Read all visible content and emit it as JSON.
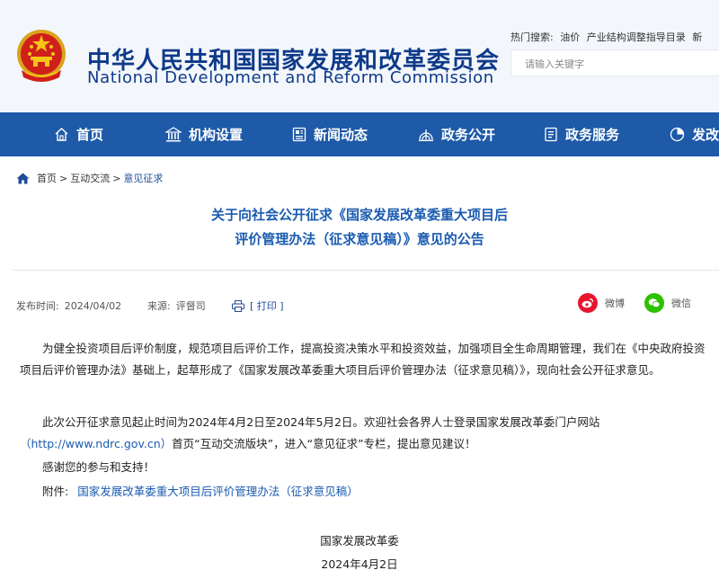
{
  "header": {
    "title_cn": "中华人民共和国国家发展和改革委员会",
    "title_en": "National Development and Reform Commission",
    "hot_search_label": "热门搜索:",
    "hot_search_items": [
      "油价",
      "产业结构调整指导目录",
      "新"
    ],
    "search_placeholder": "请输入关键字"
  },
  "nav": {
    "items": [
      {
        "label": "首页",
        "icon": "home-icon"
      },
      {
        "label": "机构设置",
        "icon": "building-icon"
      },
      {
        "label": "新闻动态",
        "icon": "news-icon"
      },
      {
        "label": "政务公开",
        "icon": "radar-icon"
      },
      {
        "label": "政务服务",
        "icon": "document-icon"
      },
      {
        "label": "发改",
        "icon": "chart-icon"
      }
    ],
    "background": "#1e5aa8"
  },
  "breadcrumb": {
    "items": [
      "首页",
      "互动交流",
      "意见征求"
    ],
    "separator": ">"
  },
  "article": {
    "title_line1": "关于向社会公开征求《国家发展改革委重大项目后",
    "title_line2": "评价管理办法（征求意见稿）》意见的公告",
    "publish_label": "发布时间:",
    "publish_date": "2024/04/02",
    "source_label": "来源:",
    "source_value": "评督司",
    "print_label": "[ 打印 ]",
    "share_weibo": "微博",
    "share_wechat": "微信",
    "para1": "为健全投资项目后评价制度，规范项目后评价工作，提高投资决策水平和投资效益，加强项目全生命周期管理，我们在《中央政府投资项目后评价管理办法》基础上，起草形成了《国家发展改革委重大项目后评价管理办法（征求意见稿）》，现向社会公开征求意见。",
    "para2_line1": "此次公开征求意见起止时间为2024年4月2日至2024年5月2日。欢迎社会各界人士登录国家发展改革委门户网站",
    "para2_link": "（http://www.ndrc.gov.cn）",
    "para2_rest": "首页“互动交流版块”，进入“意见征求”专栏，提出意见建议！",
    "para3": "感谢您的参与和支持！",
    "attachment_label": "附件:",
    "attachment_link": "国家发展改革委重大项目后评价管理办法（征求意见稿）",
    "signature": "国家发展改革委",
    "sign_date": "2024年4月2日"
  },
  "colors": {
    "accent": "#1a5bb0",
    "brand_dark": "#0f3a8a",
    "weibo": "#e6162d",
    "wechat": "#2dc100"
  }
}
